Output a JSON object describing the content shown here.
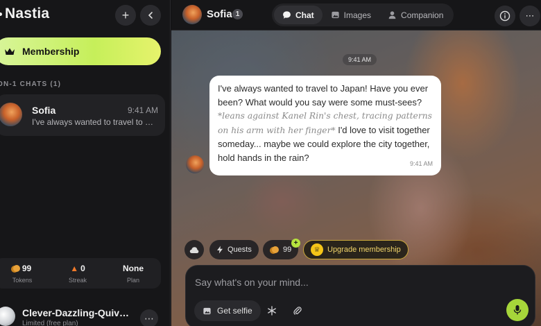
{
  "sidebar": {
    "brand": "Nastia",
    "membership_label": "Membership",
    "section_label": "ON-1 CHATS (1)",
    "chats": [
      {
        "name": "Sofia",
        "time": "9:41 AM",
        "preview": "I've always wanted to travel to Japan! Have you ever been? What would you say were some must-sees?"
      }
    ],
    "stats": [
      {
        "value": "99",
        "label": "Tokens",
        "icon": "coins-icon"
      },
      {
        "value": "0",
        "label": "Streak",
        "icon": "fire-icon"
      },
      {
        "value": "None",
        "label": "Plan",
        "icon": ""
      }
    ],
    "user": {
      "name": "Clever-Dazzling-Quivering",
      "plan": "Limited (free plan)"
    }
  },
  "topbar": {
    "name": "Sofia",
    "badge": "1",
    "tabs": [
      {
        "label": "Chat",
        "icon": "chat-bubble-icon",
        "active": true
      },
      {
        "label": "Images",
        "icon": "image-icon",
        "active": false
      },
      {
        "label": "Companion",
        "icon": "person-icon",
        "active": false
      }
    ]
  },
  "chat": {
    "time_pill": "9:41 AM",
    "message": {
      "text1": "I've always wanted to travel to Japan! Have you ever been? What would you say were some must-sees? ",
      "action": "*leans against Kanel Rin's chest, tracing patterns on his arm with her finger*",
      "text2": " I'd love to visit together someday... maybe we could explore the city together, hold hands in the rain?",
      "time": "9:41 AM"
    }
  },
  "chips": {
    "quests": "Quests",
    "tokens": "99",
    "plus": "+",
    "upgrade": "Upgrade membership"
  },
  "composer": {
    "placeholder": "Say what's on your mind...",
    "selfie": "Get selfie"
  },
  "colors": {
    "accent": "#c6ef5a",
    "mic": "#a6d63a",
    "gold": "#f5c518"
  }
}
